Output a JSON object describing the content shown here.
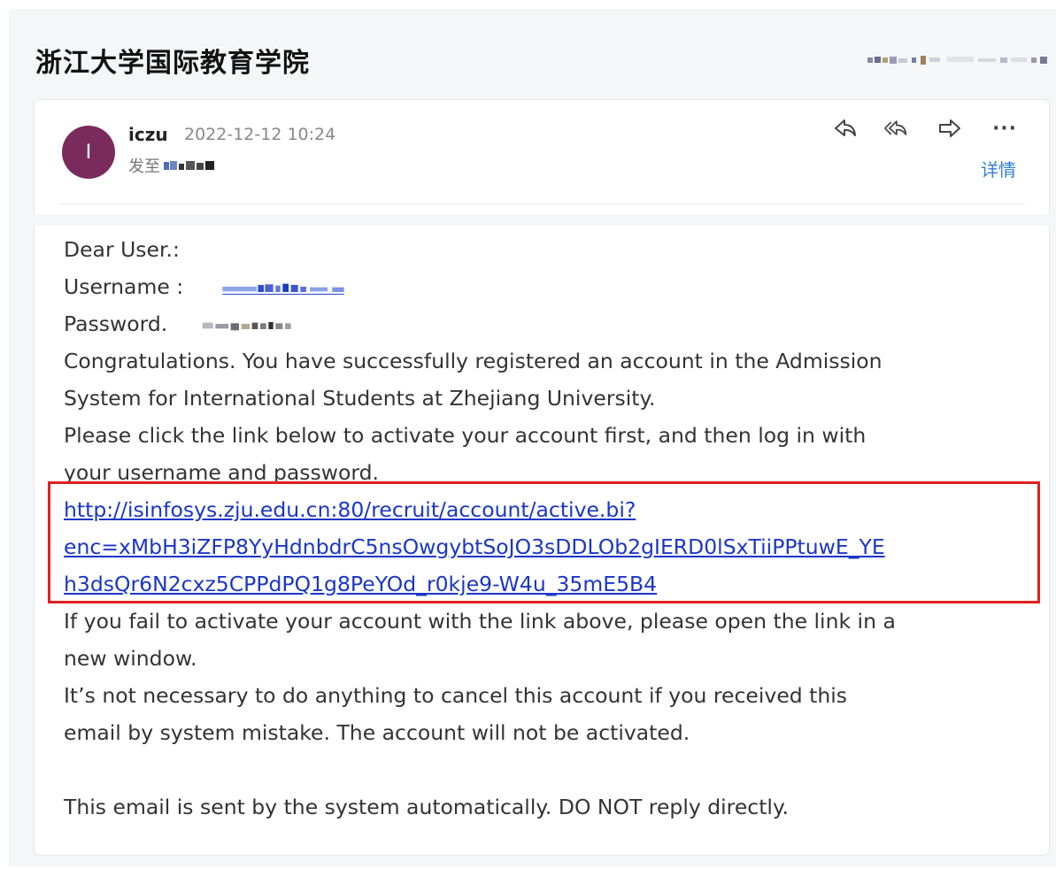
{
  "email": {
    "subject": "浙江大学国际教育学院",
    "sender": {
      "avatar_letter": "I",
      "name": "iczu",
      "time": "2022-12-12 10:24",
      "to_label": "发至"
    },
    "actions": {
      "details": "详情",
      "more": "···"
    },
    "body": {
      "greeting": "Dear User.:",
      "username_label": "Username :",
      "password_label": "Password.",
      "para1_line1": "Congratulations. You have successfully registered an account in the Admission",
      "para1_line2": "System for International Students at Zhejiang University.",
      "para2_line1": "Please click the link below to activate your account first, and then log in with",
      "para2_line2": "your username and password.",
      "link_line1": "http://isinfosys.zju.edu.cn:80/recruit/account/active.bi?",
      "link_line2": "enc=xMbH3iZFP8YyHdnbdrC5nsOwgybtSoJO3sDDLOb2gIERD0lSxTiiPPtuwE_YE",
      "link_line3": "h3dsQr6N2cxz5CPPdPQ1g8PeYOd_r0kje9-W4u_35mE5B4",
      "para3_line1": "If you fail to activate your account with the link above, please open the link in a",
      "para3_line2": "new window.",
      "para4_line1": "It’s not necessary to do anything to cancel this account if you received this",
      "para4_line2": "email by system mistake. The account will not be activated.",
      "footer": "This email is sent by the system automatically. DO NOT reply directly."
    }
  },
  "colors": {
    "avatar": "#7a2b5e",
    "link": "#1a36c9",
    "highlight_box": "#e02020",
    "details": "#2f7fd6"
  },
  "icons": [
    "reply-icon",
    "reply-all-icon",
    "forward-icon",
    "more-icon"
  ]
}
